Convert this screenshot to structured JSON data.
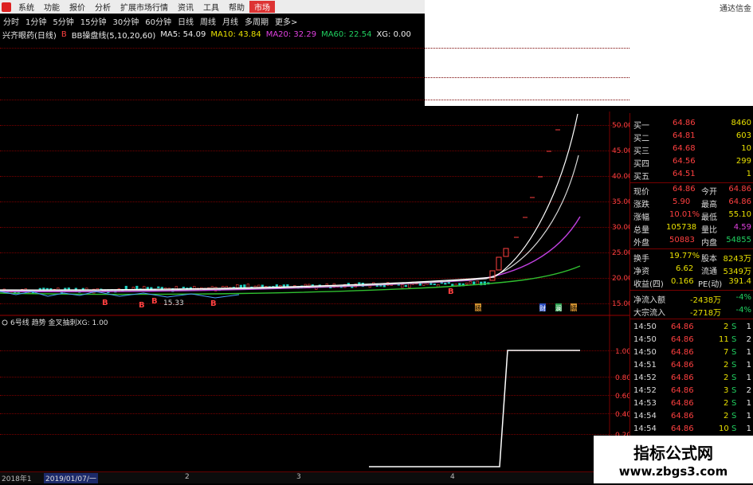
{
  "menubar": {
    "items": [
      "系统",
      "功能",
      "报价",
      "分析",
      "扩展市场行情",
      "资讯",
      "工具",
      "帮助",
      "市场"
    ],
    "active_item": "市场",
    "right_text": "通达信金"
  },
  "periods": [
    "分时",
    "1分钟",
    "5分钟",
    "15分钟",
    "30分钟",
    "60分钟",
    "日线",
    "周线",
    "月线",
    "多周期",
    "更多>"
  ],
  "indicator_line": {
    "stock": "兴齐眼药(日线)",
    "badge": "B",
    "formula": "BB操盘线(5,10,20,60)",
    "ma5": "MA5: 54.09",
    "ma10": "MA10: 43.84",
    "ma20": "MA20: 32.29",
    "ma60": "MA60: 22.54",
    "xg": "XG: 0.00"
  },
  "main_chart": {
    "yticks": [
      "50.00",
      "45.00",
      "40.00",
      "35.00",
      "30.00",
      "25.00",
      "20.00",
      "15.00"
    ],
    "low_label": "15.33",
    "buy_markers": [
      "B",
      "B",
      "B",
      "B",
      "B"
    ],
    "event_labels": [
      "扬",
      "财",
      "澜",
      "扬"
    ]
  },
  "sub_chart": {
    "title": "6号线 趋势 金叉抽刺XG: 1.00",
    "yticks": [
      "1.00",
      "0.80",
      "0.60",
      "0.40",
      "0.20"
    ]
  },
  "xaxis": {
    "labels": [
      "2018年1",
      "2019/01/07/一",
      "2",
      "3",
      "4"
    ]
  },
  "quotes": {
    "order_book": [
      {
        "label": "买一",
        "price": "64.86",
        "vol": "8460"
      },
      {
        "label": "买二",
        "price": "64.81",
        "vol": "603"
      },
      {
        "label": "买三",
        "price": "64.68",
        "vol": "10"
      },
      {
        "label": "买四",
        "price": "64.56",
        "vol": "299"
      },
      {
        "label": "买五",
        "price": "64.51",
        "vol": "1"
      }
    ],
    "stats": [
      {
        "l1": "现价",
        "v1": "64.86",
        "l2": "今开",
        "v2": "64.86"
      },
      {
        "l1": "涨跌",
        "v1": "5.90",
        "l2": "最高",
        "v2": "64.86"
      },
      {
        "l1": "涨幅",
        "v1": "10.01%",
        "l2": "最低",
        "v2": "55.10"
      },
      {
        "l1": "总量",
        "v1": "105738",
        "l2": "量比",
        "v2": "4.59"
      },
      {
        "l1": "外盘",
        "v1": "50883",
        "l2": "内盘",
        "v2": "54855"
      }
    ],
    "stats2": [
      {
        "l1": "换手",
        "v1": "19.77%",
        "l2": "股本",
        "v2": "8243万"
      },
      {
        "l1": "净资",
        "v1": "6.62",
        "l2": "流通",
        "v2": "5349万"
      },
      {
        "l1": "收益(四)",
        "v1": "0.166",
        "l2": "PE(动)",
        "v2": "391.4"
      }
    ],
    "flows": [
      {
        "label": "净流入额",
        "value": "-2438万",
        "pct": "-4%"
      },
      {
        "label": "大宗流入",
        "value": "-2718万",
        "pct": "-4%"
      }
    ],
    "ticks": [
      {
        "time": "14:50",
        "price": "64.86",
        "vol": "2",
        "side": "S",
        "extra": "1"
      },
      {
        "time": "14:50",
        "price": "64.86",
        "vol": "11",
        "side": "S",
        "extra": "2"
      },
      {
        "time": "14:50",
        "price": "64.86",
        "vol": "7",
        "side": "S",
        "extra": "1"
      },
      {
        "time": "14:51",
        "price": "64.86",
        "vol": "2",
        "side": "S",
        "extra": "1"
      },
      {
        "time": "14:52",
        "price": "64.86",
        "vol": "2",
        "side": "S",
        "extra": "1"
      },
      {
        "time": "14:52",
        "price": "64.86",
        "vol": "3",
        "side": "S",
        "extra": "2"
      },
      {
        "time": "14:53",
        "price": "64.86",
        "vol": "2",
        "side": "S",
        "extra": "1"
      },
      {
        "time": "14:54",
        "price": "64.86",
        "vol": "2",
        "side": "S",
        "extra": "1"
      },
      {
        "time": "14:54",
        "price": "64.86",
        "vol": "10",
        "side": "S",
        "extra": "1"
      }
    ]
  },
  "watermark": {
    "title": "指标公式网",
    "url": "www.zbgs3.com"
  },
  "colors": {
    "up": "#ff4040",
    "down": "#20d060",
    "ma5": "#ffffff",
    "ma10": "#e8e000",
    "ma20": "#c040e0",
    "ma60": "#30c030",
    "grid": "#700000"
  }
}
